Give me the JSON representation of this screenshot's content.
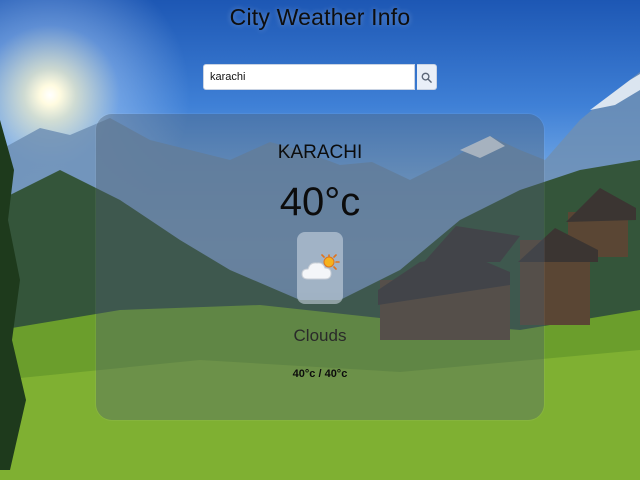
{
  "page": {
    "title": "City Weather Info"
  },
  "search": {
    "value": "karachi",
    "button_icon": "search-icon"
  },
  "weather": {
    "city": "KARACHI",
    "temperature": "40°c",
    "icon": "partly-cloudy-icon",
    "condition": "Clouds",
    "min_max": "40°c / 40°c"
  },
  "colors": {
    "card_background": "#505f6e",
    "text": "#0c0c0c"
  }
}
